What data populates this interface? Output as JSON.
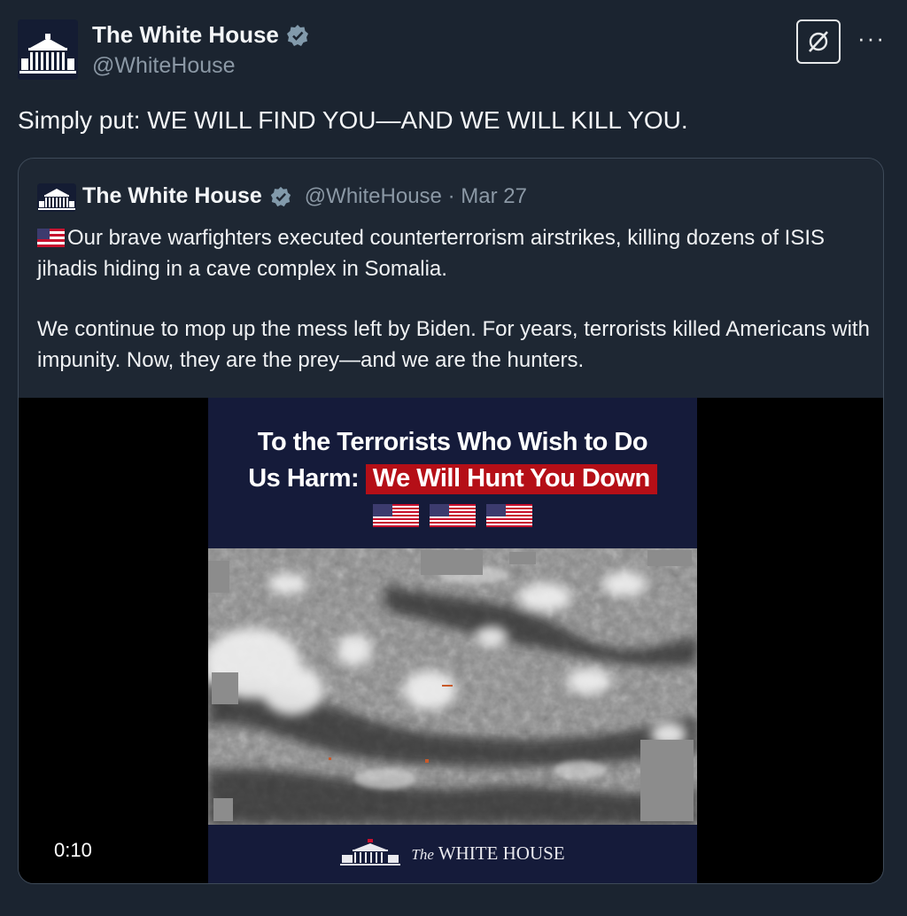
{
  "tweet": {
    "author_name": "The White House",
    "author_handle": "@WhiteHouse",
    "text": "Simply put: WE WILL FIND YOU—AND WE WILL KILL YOU.",
    "more_label": "···"
  },
  "quoted": {
    "author_name": "The White House",
    "author_handle": "@WhiteHouse",
    "separator": "·",
    "date": "Mar 27",
    "paragraph1": "Our brave warfighters executed counterterrorism airstrikes, killing dozens of ISIS jihadis hiding in a cave complex in Somalia.",
    "paragraph2": "We continue to mop up the mess left by Biden. For years, terrorists killed Americans with impunity. Now, they are the prey—and we are the hunters."
  },
  "video": {
    "title_line1": "To the Terrorists Who Wish to Do",
    "title_line2_prefix": "Us Harm:",
    "title_highlight": "We Will Hunt You Down",
    "duration": "0:10",
    "footer_the": "The",
    "footer_name": "WHITE HOUSE"
  },
  "colors": {
    "background": "#1b2430",
    "verified_badge": "#829aab",
    "highlight_red": "#b50f17",
    "video_bg": "#151b3a"
  },
  "icons": [
    "white-house-logo-icon",
    "verified-badge-icon",
    "grok-icon",
    "more-icon",
    "us-flag-icon"
  ]
}
